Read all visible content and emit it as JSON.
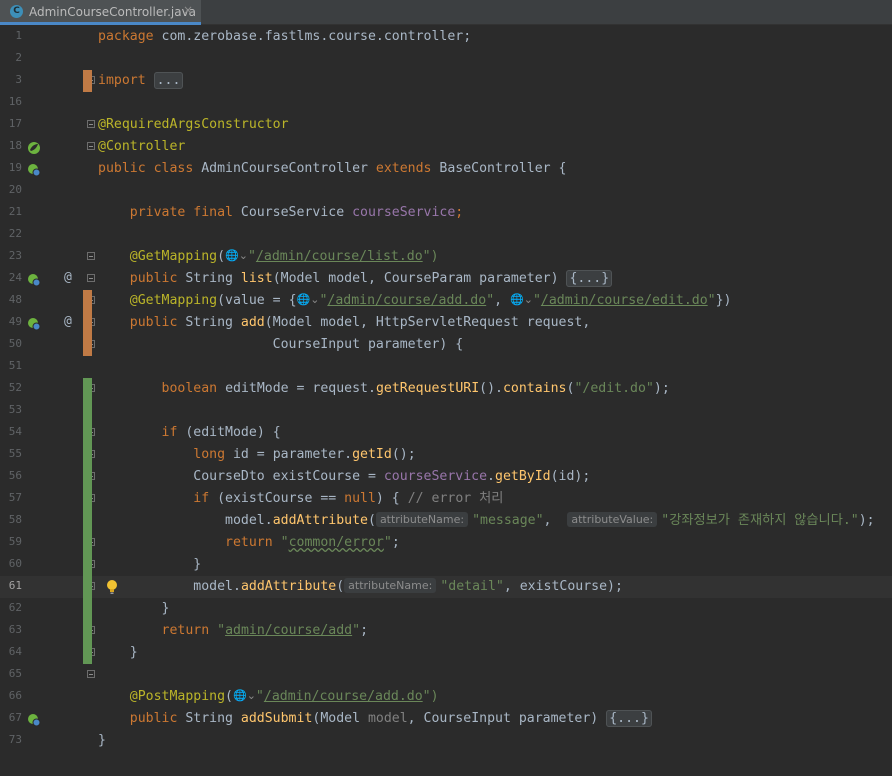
{
  "tab": {
    "icon": "C",
    "filename": "AdminCourseController.java",
    "close": "×"
  },
  "colors": {
    "background": "#2b2b2b",
    "keyword": "#cc7832",
    "annotation": "#bbb529",
    "string": "#6a8759",
    "field": "#9876aa",
    "method": "#ffc66d",
    "comment": "#808080",
    "vcs_modified": "#c07a45",
    "vcs_added": "#629755"
  },
  "lines": [
    {
      "n": "1",
      "tokens": [
        {
          "t": "package ",
          "c": "kw"
        },
        {
          "t": "com.zerobase.fastlms.course.controller;"
        }
      ]
    },
    {
      "n": "2",
      "tokens": []
    },
    {
      "n": "3",
      "tokens": [
        {
          "t": "import ",
          "c": "kw"
        },
        {
          "t": "...",
          "c": "fold"
        }
      ]
    },
    {
      "n": "16",
      "tokens": []
    },
    {
      "n": "17",
      "tokens": [
        {
          "t": "@RequiredArgsConstructor",
          "c": "an"
        }
      ]
    },
    {
      "n": "18",
      "tokens": [
        {
          "t": "@Controller",
          "c": "an"
        }
      ],
      "gutter_icon": "spring-bean-icon"
    },
    {
      "n": "19",
      "tokens": [
        {
          "t": "public class ",
          "c": "kw"
        },
        {
          "t": "AdminCourseController "
        },
        {
          "t": "extends ",
          "c": "kw"
        },
        {
          "t": "BaseController {"
        }
      ],
      "gutter_icon": "spring-web-icon"
    },
    {
      "n": "20",
      "tokens": []
    },
    {
      "n": "21",
      "tokens": [
        {
          "t": "    "
        },
        {
          "t": "private final ",
          "c": "kw"
        },
        {
          "t": "CourseService "
        },
        {
          "t": "courseService",
          "c": "fld"
        },
        {
          "t": ";",
          "c": "kw"
        }
      ]
    },
    {
      "n": "22",
      "tokens": []
    },
    {
      "n": "23",
      "tokens": [
        {
          "t": "    "
        },
        {
          "t": "@GetMapping",
          "c": "an"
        },
        {
          "t": "("
        },
        {
          "t": "🌐⌄",
          "c": "globe"
        },
        {
          "t": "\"",
          "c": "str"
        },
        {
          "t": "/admin/course/list.do",
          "c": "str u"
        },
        {
          "t": "\")",
          "c": "str"
        }
      ]
    },
    {
      "n": "24",
      "tokens": [
        {
          "t": "    "
        },
        {
          "t": "public ",
          "c": "kw"
        },
        {
          "t": "String "
        },
        {
          "t": "list",
          "c": "mth"
        },
        {
          "t": "(Model "
        },
        {
          "t": "model",
          "c": "par"
        },
        {
          "t": ", CourseParam "
        },
        {
          "t": "parameter",
          "c": "par"
        },
        {
          "t": ") "
        },
        {
          "t": "{...}",
          "c": "fold"
        }
      ],
      "gutter_icon": "spring-web-icon",
      "at": "@"
    },
    {
      "n": "48",
      "tokens": [
        {
          "t": "    "
        },
        {
          "t": "@GetMapping",
          "c": "an"
        },
        {
          "t": "(value = {"
        },
        {
          "t": "🌐⌄",
          "c": "globe"
        },
        {
          "t": "\"",
          "c": "str"
        },
        {
          "t": "/admin/course/add.do",
          "c": "str u"
        },
        {
          "t": "\"",
          "c": "str"
        },
        {
          "t": ", "
        },
        {
          "t": "🌐⌄",
          "c": "globe"
        },
        {
          "t": "\"",
          "c": "str"
        },
        {
          "t": "/admin/course/edit.do",
          "c": "str u"
        },
        {
          "t": "\"",
          "c": "str"
        },
        {
          "t": "})"
        }
      ]
    },
    {
      "n": "49",
      "tokens": [
        {
          "t": "    "
        },
        {
          "t": "public ",
          "c": "kw"
        },
        {
          "t": "String "
        },
        {
          "t": "add",
          "c": "mth"
        },
        {
          "t": "(Model "
        },
        {
          "t": "model",
          "c": "par"
        },
        {
          "t": ", HttpServletRequest "
        },
        {
          "t": "request",
          "c": "par"
        },
        {
          "t": ","
        }
      ],
      "gutter_icon": "spring-web-icon",
      "at": "@"
    },
    {
      "n": "50",
      "tokens": [
        {
          "t": "                      CourseInput "
        },
        {
          "t": "parameter",
          "c": "par"
        },
        {
          "t": ") {"
        }
      ]
    },
    {
      "n": "51",
      "tokens": []
    },
    {
      "n": "52",
      "tokens": [
        {
          "t": "        "
        },
        {
          "t": "boolean ",
          "c": "kw"
        },
        {
          "t": "editMode = "
        },
        {
          "t": "request",
          "c": "par"
        },
        {
          "t": "."
        },
        {
          "t": "getRequestURI",
          "c": "mth"
        },
        {
          "t": "()."
        },
        {
          "t": "contains",
          "c": "mth"
        },
        {
          "t": "("
        },
        {
          "t": "\"/edit.do\"",
          "c": "str"
        },
        {
          "t": ");"
        }
      ]
    },
    {
      "n": "53",
      "tokens": []
    },
    {
      "n": "54",
      "tokens": [
        {
          "t": "        "
        },
        {
          "t": "if ",
          "c": "kw"
        },
        {
          "t": "(editMode) {"
        }
      ]
    },
    {
      "n": "55",
      "tokens": [
        {
          "t": "            "
        },
        {
          "t": "long ",
          "c": "kw"
        },
        {
          "t": "id = "
        },
        {
          "t": "parameter",
          "c": "par"
        },
        {
          "t": "."
        },
        {
          "t": "getId",
          "c": "mth"
        },
        {
          "t": "();"
        }
      ]
    },
    {
      "n": "56",
      "tokens": [
        {
          "t": "            CourseDto existCourse = "
        },
        {
          "t": "courseService",
          "c": "fld"
        },
        {
          "t": "."
        },
        {
          "t": "getById",
          "c": "mth"
        },
        {
          "t": "(id);"
        }
      ]
    },
    {
      "n": "57",
      "tokens": [
        {
          "t": "            "
        },
        {
          "t": "if ",
          "c": "kw"
        },
        {
          "t": "(existCourse == "
        },
        {
          "t": "null",
          "c": "kw"
        },
        {
          "t": ") { "
        },
        {
          "t": "// error 처리",
          "c": "cmt"
        }
      ]
    },
    {
      "n": "58",
      "tokens": [
        {
          "t": "                "
        },
        {
          "t": "model",
          "c": "par"
        },
        {
          "t": "."
        },
        {
          "t": "addAttribute",
          "c": "mth"
        },
        {
          "t": "("
        },
        {
          "t": "attributeName:",
          "c": "hint"
        },
        {
          "t": "\"message\"",
          "c": "str"
        },
        {
          "t": ",  "
        },
        {
          "t": "attributeValue:",
          "c": "hint"
        },
        {
          "t": "\"강좌정보가 존재하지 않습니다.\"",
          "c": "str"
        },
        {
          "t": ");"
        }
      ]
    },
    {
      "n": "59",
      "tokens": [
        {
          "t": "                "
        },
        {
          "t": "return ",
          "c": "kw"
        },
        {
          "t": "\"",
          "c": "str"
        },
        {
          "t": "common/error",
          "c": "str wavy"
        },
        {
          "t": "\"",
          "c": "str"
        },
        {
          "t": ";"
        }
      ]
    },
    {
      "n": "60",
      "tokens": [
        {
          "t": "            }"
        }
      ]
    },
    {
      "n": "61",
      "tokens": [
        {
          "t": "            "
        },
        {
          "t": "model",
          "c": "par"
        },
        {
          "t": "."
        },
        {
          "t": "addAttribute",
          "c": "mth"
        },
        {
          "t": "("
        },
        {
          "t": "attributeName:",
          "c": "hint"
        },
        {
          "t": "\"detail\"",
          "c": "str"
        },
        {
          "t": ", existCourse);"
        }
      ],
      "current": true,
      "bulb": true
    },
    {
      "n": "62",
      "tokens": [
        {
          "t": "        }"
        }
      ]
    },
    {
      "n": "63",
      "tokens": [
        {
          "t": "        "
        },
        {
          "t": "return ",
          "c": "kw"
        },
        {
          "t": "\"",
          "c": "str"
        },
        {
          "t": "admin/course/add",
          "c": "str u"
        },
        {
          "t": "\"",
          "c": "str"
        },
        {
          "t": ";"
        }
      ]
    },
    {
      "n": "64",
      "tokens": [
        {
          "t": "    }"
        }
      ]
    },
    {
      "n": "65",
      "tokens": []
    },
    {
      "n": "66",
      "tokens": [
        {
          "t": "    "
        },
        {
          "t": "@PostMapping",
          "c": "an"
        },
        {
          "t": "("
        },
        {
          "t": "🌐⌄",
          "c": "globe"
        },
        {
          "t": "\"",
          "c": "str"
        },
        {
          "t": "/admin/course/add.do",
          "c": "str u"
        },
        {
          "t": "\")",
          "c": "str"
        }
      ]
    },
    {
      "n": "67",
      "tokens": [
        {
          "t": "    "
        },
        {
          "t": "public ",
          "c": "kw"
        },
        {
          "t": "String "
        },
        {
          "t": "addSubmit",
          "c": "mth"
        },
        {
          "t": "(Model "
        },
        {
          "t": "model",
          "c": "cmt"
        },
        {
          "t": ", CourseInput "
        },
        {
          "t": "parameter",
          "c": "par"
        },
        {
          "t": ") "
        },
        {
          "t": "{...}",
          "c": "fold"
        }
      ],
      "gutter_icon": "spring-web-icon"
    },
    {
      "n": "73",
      "tokens": [
        {
          "t": "}"
        }
      ]
    }
  ]
}
